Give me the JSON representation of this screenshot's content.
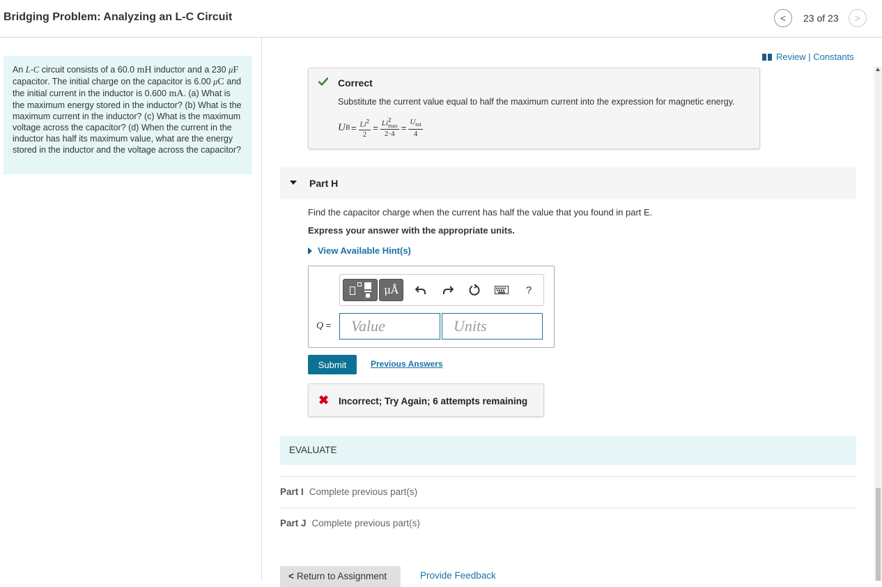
{
  "header": {
    "title": "Bridging Problem: Analyzing an L-C Circuit",
    "counter": "23 of 23",
    "prev_glyph": "<",
    "next_glyph": ">"
  },
  "problem": {
    "t1": "An ",
    "L": "L",
    "dash": "-",
    "C": "C",
    "t2": " circuit consists of a 60.0 ",
    "mH": "mH",
    "t3": " inductor and a 230 ",
    "mu1": "μ",
    "F": "F",
    "t4": " capacitor. The initial charge on the capacitor is 6.00 ",
    "mu2": "μ",
    "Cunit": "C",
    "t5": " and the initial current in the inductor is 0.600 ",
    "mA": "mA",
    "t6": ". (a) What is the maximum energy stored in the inductor? (b) What is the maximum current in the inductor? (c) What is the maximum voltage across the capacitor? (d) When the current in the inductor has half its maximum value, what are the energy stored in the inductor and the voltage across the capacitor?"
  },
  "review": {
    "text": "Review | Constants"
  },
  "correct": {
    "title": "Correct",
    "text": "Substitute the current value equal to half the maximum current into the expression for magnetic energy.",
    "formula": {
      "lhs_U": "U",
      "lhs_sub": "B",
      "eq": "=",
      "f1_num_L": "Li",
      "f1_num_sup": "2",
      "f1_den": "2",
      "f2_num_L": "Li",
      "f2_num_sup": "2",
      "f2_num_sub": "max",
      "f2_den": "2·4",
      "f3_num_U": "U",
      "f3_num_sub": "tot",
      "f3_den": "4"
    }
  },
  "part_h": {
    "label": "Part H",
    "question": "Find the capacitor charge when the current has half the value that you found in part E.",
    "instruction": "Express your answer with the appropriate units.",
    "hints": "View Available Hint(s)",
    "q_var": "Q",
    "q_eq": " =",
    "units_button": "μÅ",
    "help": "?",
    "value_placeholder": "Value",
    "units_placeholder": "Units",
    "submit": "Submit",
    "previous_answers": "Previous Answers",
    "incorrect": "Incorrect; Try Again; 6 attempts remaining"
  },
  "evaluate": {
    "label": "EVALUATE"
  },
  "parts": [
    {
      "label": "Part I",
      "status": "Complete previous part(s)"
    },
    {
      "label": "Part J",
      "status": "Complete previous part(s)"
    }
  ],
  "footer": {
    "return_glyph": "<",
    "return": "Return to Assignment",
    "feedback": "Provide Feedback"
  }
}
